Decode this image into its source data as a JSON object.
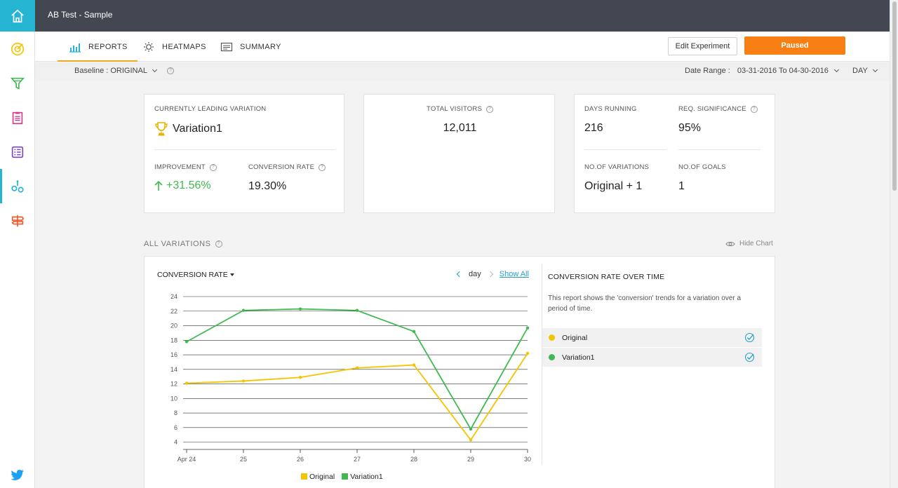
{
  "app": {
    "title": "AB Test - Sample"
  },
  "sidebar": {
    "icons": [
      "home-icon",
      "target-icon",
      "funnel-icon",
      "clipboard-icon",
      "list-icon",
      "ab-test-icon",
      "signpost-icon",
      "twitter-icon"
    ],
    "colors": {
      "home_bg": "#26b4d3",
      "target": "#f5c400",
      "funnel": "#3fb950",
      "clipboard": "#d43a8f",
      "list": "#7b45c8",
      "ab": "#26b4d3",
      "signpost": "#f05a28",
      "twitter": "#1da1f2"
    }
  },
  "tabs": [
    {
      "label": "REPORTS",
      "icon": "bar-chart-icon",
      "active": true
    },
    {
      "label": "HEATMAPS",
      "icon": "sun-icon",
      "active": false
    },
    {
      "label": "SUMMARY",
      "icon": "document-icon",
      "active": false
    }
  ],
  "actions": {
    "edit_label": "Edit Experiment",
    "status_label": "Paused",
    "status_color": "#f77f14"
  },
  "subbar": {
    "baseline": "Baseline : ORIGINAL",
    "date_range_label": "Date Range :",
    "date_range_value": "03-31-2016 To 04-30-2016",
    "granularity": "DAY"
  },
  "cards": {
    "leading": {
      "label": "CURRENTLY LEADING VARIATION",
      "value": "Variation1",
      "improvement_label": "IMPROVEMENT",
      "improvement_value": "+31.56%",
      "conversion_label": "CONVERSION RATE",
      "conversion_value": "19.30%"
    },
    "visitors": {
      "label": "TOTAL VISITORS",
      "value": "12,011"
    },
    "meta": {
      "days_label": "DAYS RUNNING",
      "days_value": "216",
      "sig_label": "REQ. SIGNIFICANCE",
      "sig_value": "95%",
      "variations_label": "NO.OF VARIATIONS",
      "variations_value": "Original + 1",
      "goals_label": "NO.OF GOALS",
      "goals_value": "1"
    }
  },
  "section": {
    "title": "ALL VARIATIONS",
    "hide_chart": "Hide Chart"
  },
  "chart_controls": {
    "metric": "CONVERSION RATE",
    "period": "day",
    "show_all": "Show All"
  },
  "panel": {
    "title": "CONVERSION RATE OVER TIME",
    "description": "This report shows the 'conversion' trends for a variation over a period of time.",
    "rows": [
      {
        "label": "Original",
        "color": "#f5c400"
      },
      {
        "label": "Variation1",
        "color": "#3fb950"
      }
    ]
  },
  "chart_data": {
    "type": "line",
    "categories": [
      "Apr 24",
      "25",
      "26",
      "27",
      "28",
      "29",
      "30"
    ],
    "yticks": [
      4,
      6,
      8,
      10,
      12,
      14,
      16,
      18,
      20,
      22,
      24
    ],
    "ylim": [
      3,
      24
    ],
    "grid": true,
    "legend": "bottom",
    "series": [
      {
        "name": "Original",
        "color": "#f5c400",
        "values": [
          12.1,
          12.4,
          12.9,
          14.2,
          14.6,
          4.3,
          16.2
        ]
      },
      {
        "name": "Variation1",
        "color": "#3fb950",
        "values": [
          17.8,
          22.1,
          22.3,
          22.1,
          19.2,
          5.8,
          19.7
        ]
      }
    ]
  }
}
